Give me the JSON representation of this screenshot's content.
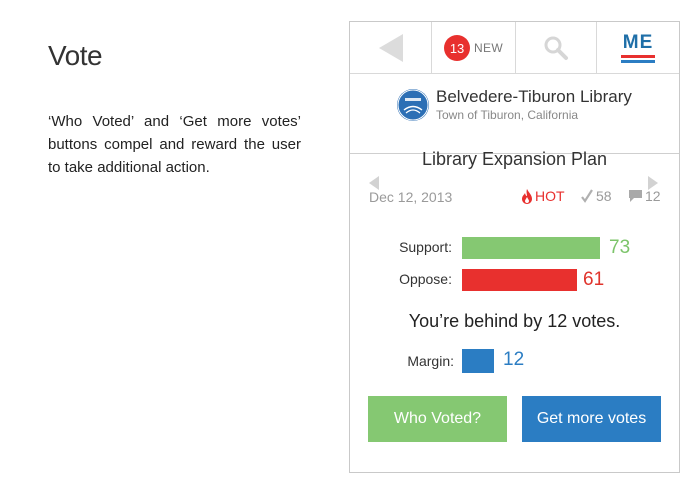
{
  "intro": {
    "title": "Vote",
    "description": "‘Who Voted’ and ‘Get more votes’ buttons compel and reward the user to take additional action."
  },
  "topbar": {
    "back_icon": "back-arrow-icon",
    "new_count": "13",
    "new_label": "NEW",
    "search_icon": "search-icon",
    "logo_text": "ME"
  },
  "org": {
    "name": "Belvedere-Tiburon Library",
    "subtitle": "Town of Tiburon, California"
  },
  "issue": {
    "title": "Library Expansion Plan",
    "date": "Dec 12, 2013",
    "hot_label": "HOT",
    "vote_count": "58",
    "comment_count": "12"
  },
  "results": {
    "support_label": "Support:",
    "support_value": "73",
    "oppose_label": "Oppose:",
    "oppose_value": "61",
    "status_text": "You’re behind by 12 votes.",
    "margin_label": "Margin:",
    "margin_value": "12"
  },
  "buttons": {
    "who_voted": "Who Voted?",
    "get_more_votes": "Get more votes"
  },
  "colors": {
    "support": "#85c872",
    "oppose": "#e8302e",
    "margin": "#2b7dc3",
    "badge": "#e8302e",
    "support_text": "#7cc46a",
    "oppose_text": "#e0342c",
    "margin_text": "#2b7dc3"
  }
}
